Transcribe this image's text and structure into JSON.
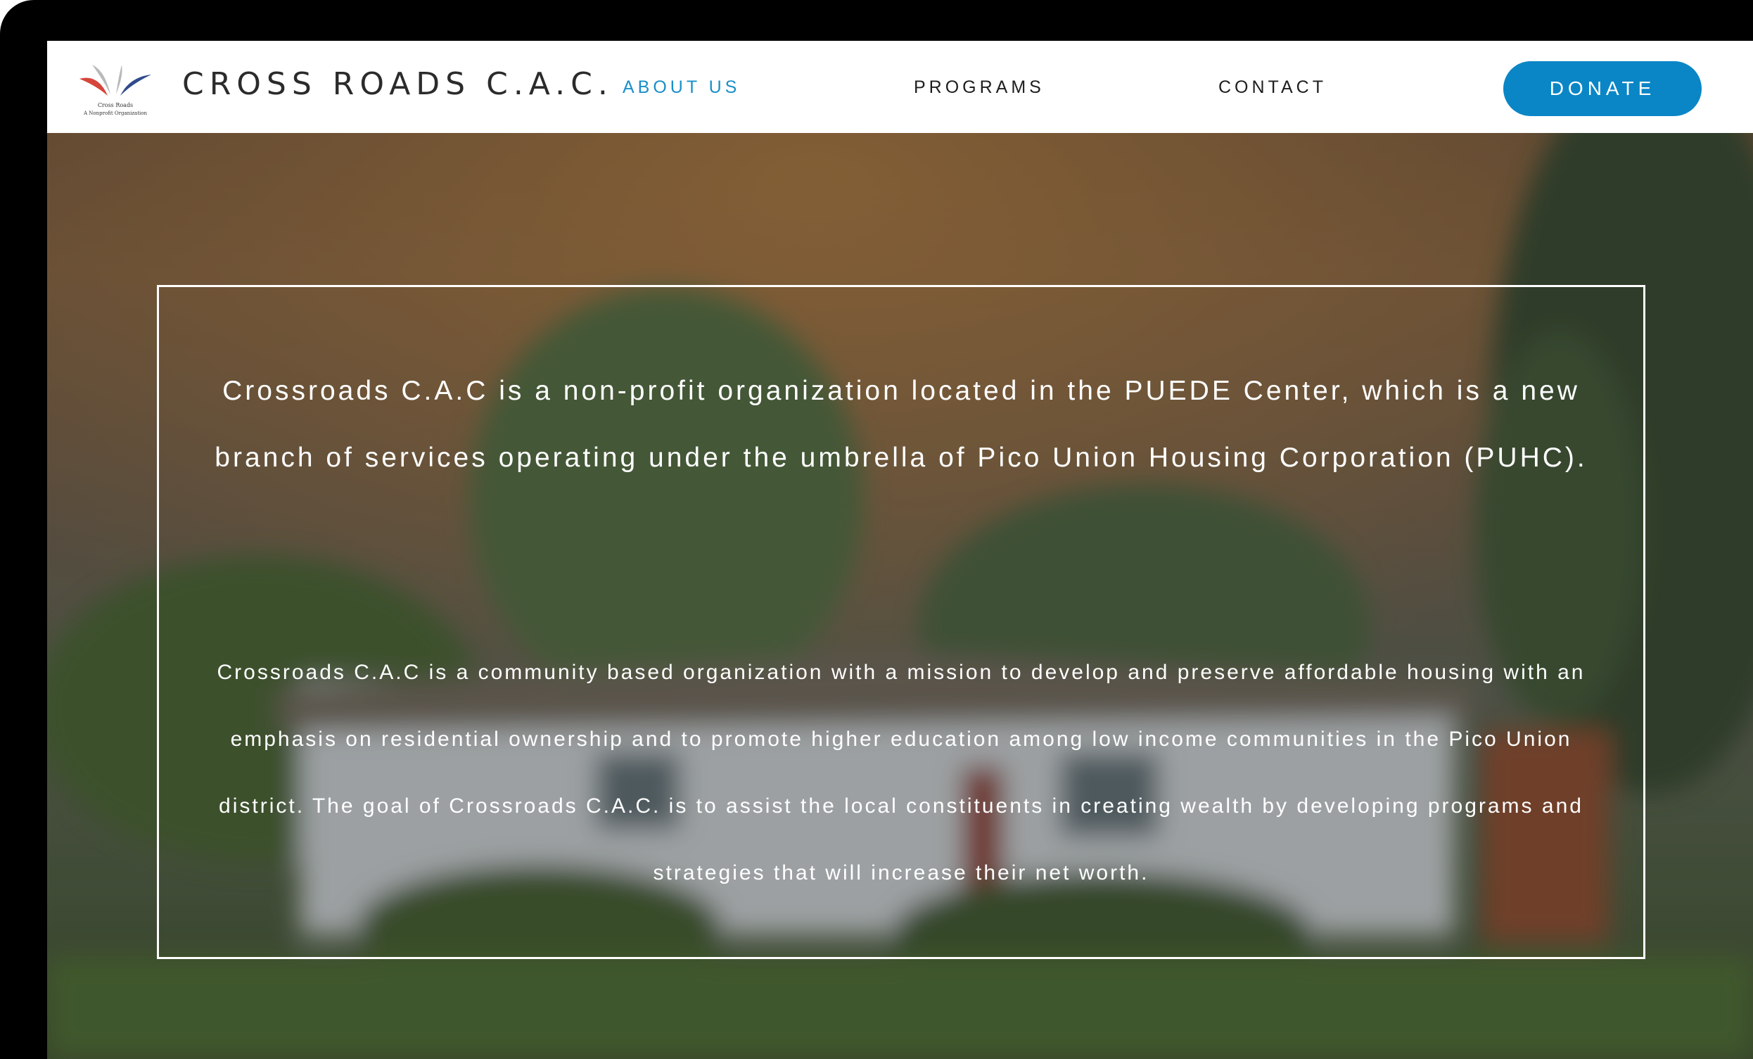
{
  "nav": {
    "logo_caption_line1": "Cross Roads",
    "logo_caption_line2": "A Nonprofit Organization",
    "brand": "CROSS ROADS C.A.C.",
    "links": [
      {
        "label": "ABOUT US",
        "active": true
      },
      {
        "label": "PROGRAMS",
        "active": false
      },
      {
        "label": "CONTACT",
        "active": false
      }
    ],
    "donate_label": "DONATE"
  },
  "hero": {
    "intro": "Crossroads C.A.C is a non-profit organization located in the PUEDE Center, which is a new branch of services operating under the umbrella of Pico Union Housing Corporation (PUHC).",
    "mission": "Crossroads C.A.C is a community based organization with a mission to develop and preserve affordable housing with an emphasis on residential ownership and to promote higher education among low income communities in the Pico Union district. The goal of Crossroads C.A.C. is to assist the local constituents in creating wealth by developing programs and strategies that will increase their net worth."
  },
  "colors": {
    "accent": "#1a8fc9",
    "donate_bg": "#0a86c6",
    "logo_red": "#d6453a",
    "logo_blue": "#2f4b8c",
    "logo_gray": "#b9b9b9"
  }
}
